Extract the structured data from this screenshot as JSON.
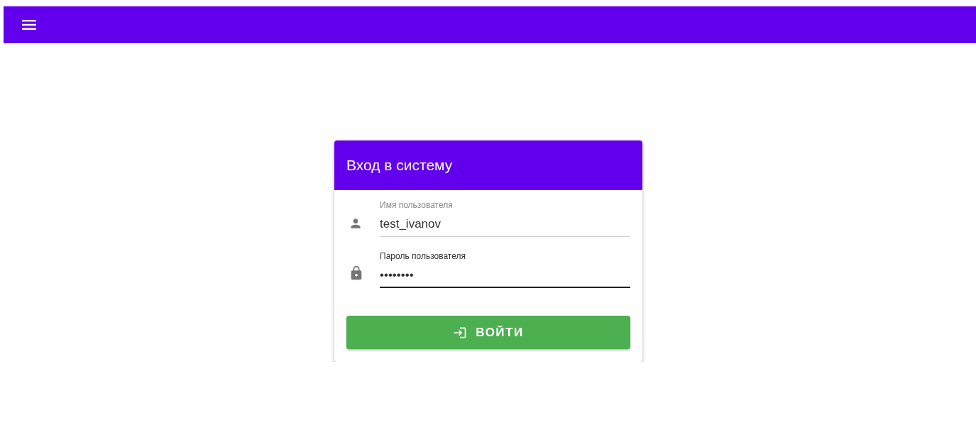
{
  "login_card": {
    "title": "Вход в систему",
    "fields": [
      {
        "kind": "user",
        "label": "Имя пользователя",
        "value": "test_ivanov",
        "focused": false
      },
      {
        "kind": "lock",
        "label": "Пароль пользователя",
        "value": "••••••••",
        "focused": true
      }
    ],
    "submit": {
      "label": "ВОЙТИ"
    }
  }
}
